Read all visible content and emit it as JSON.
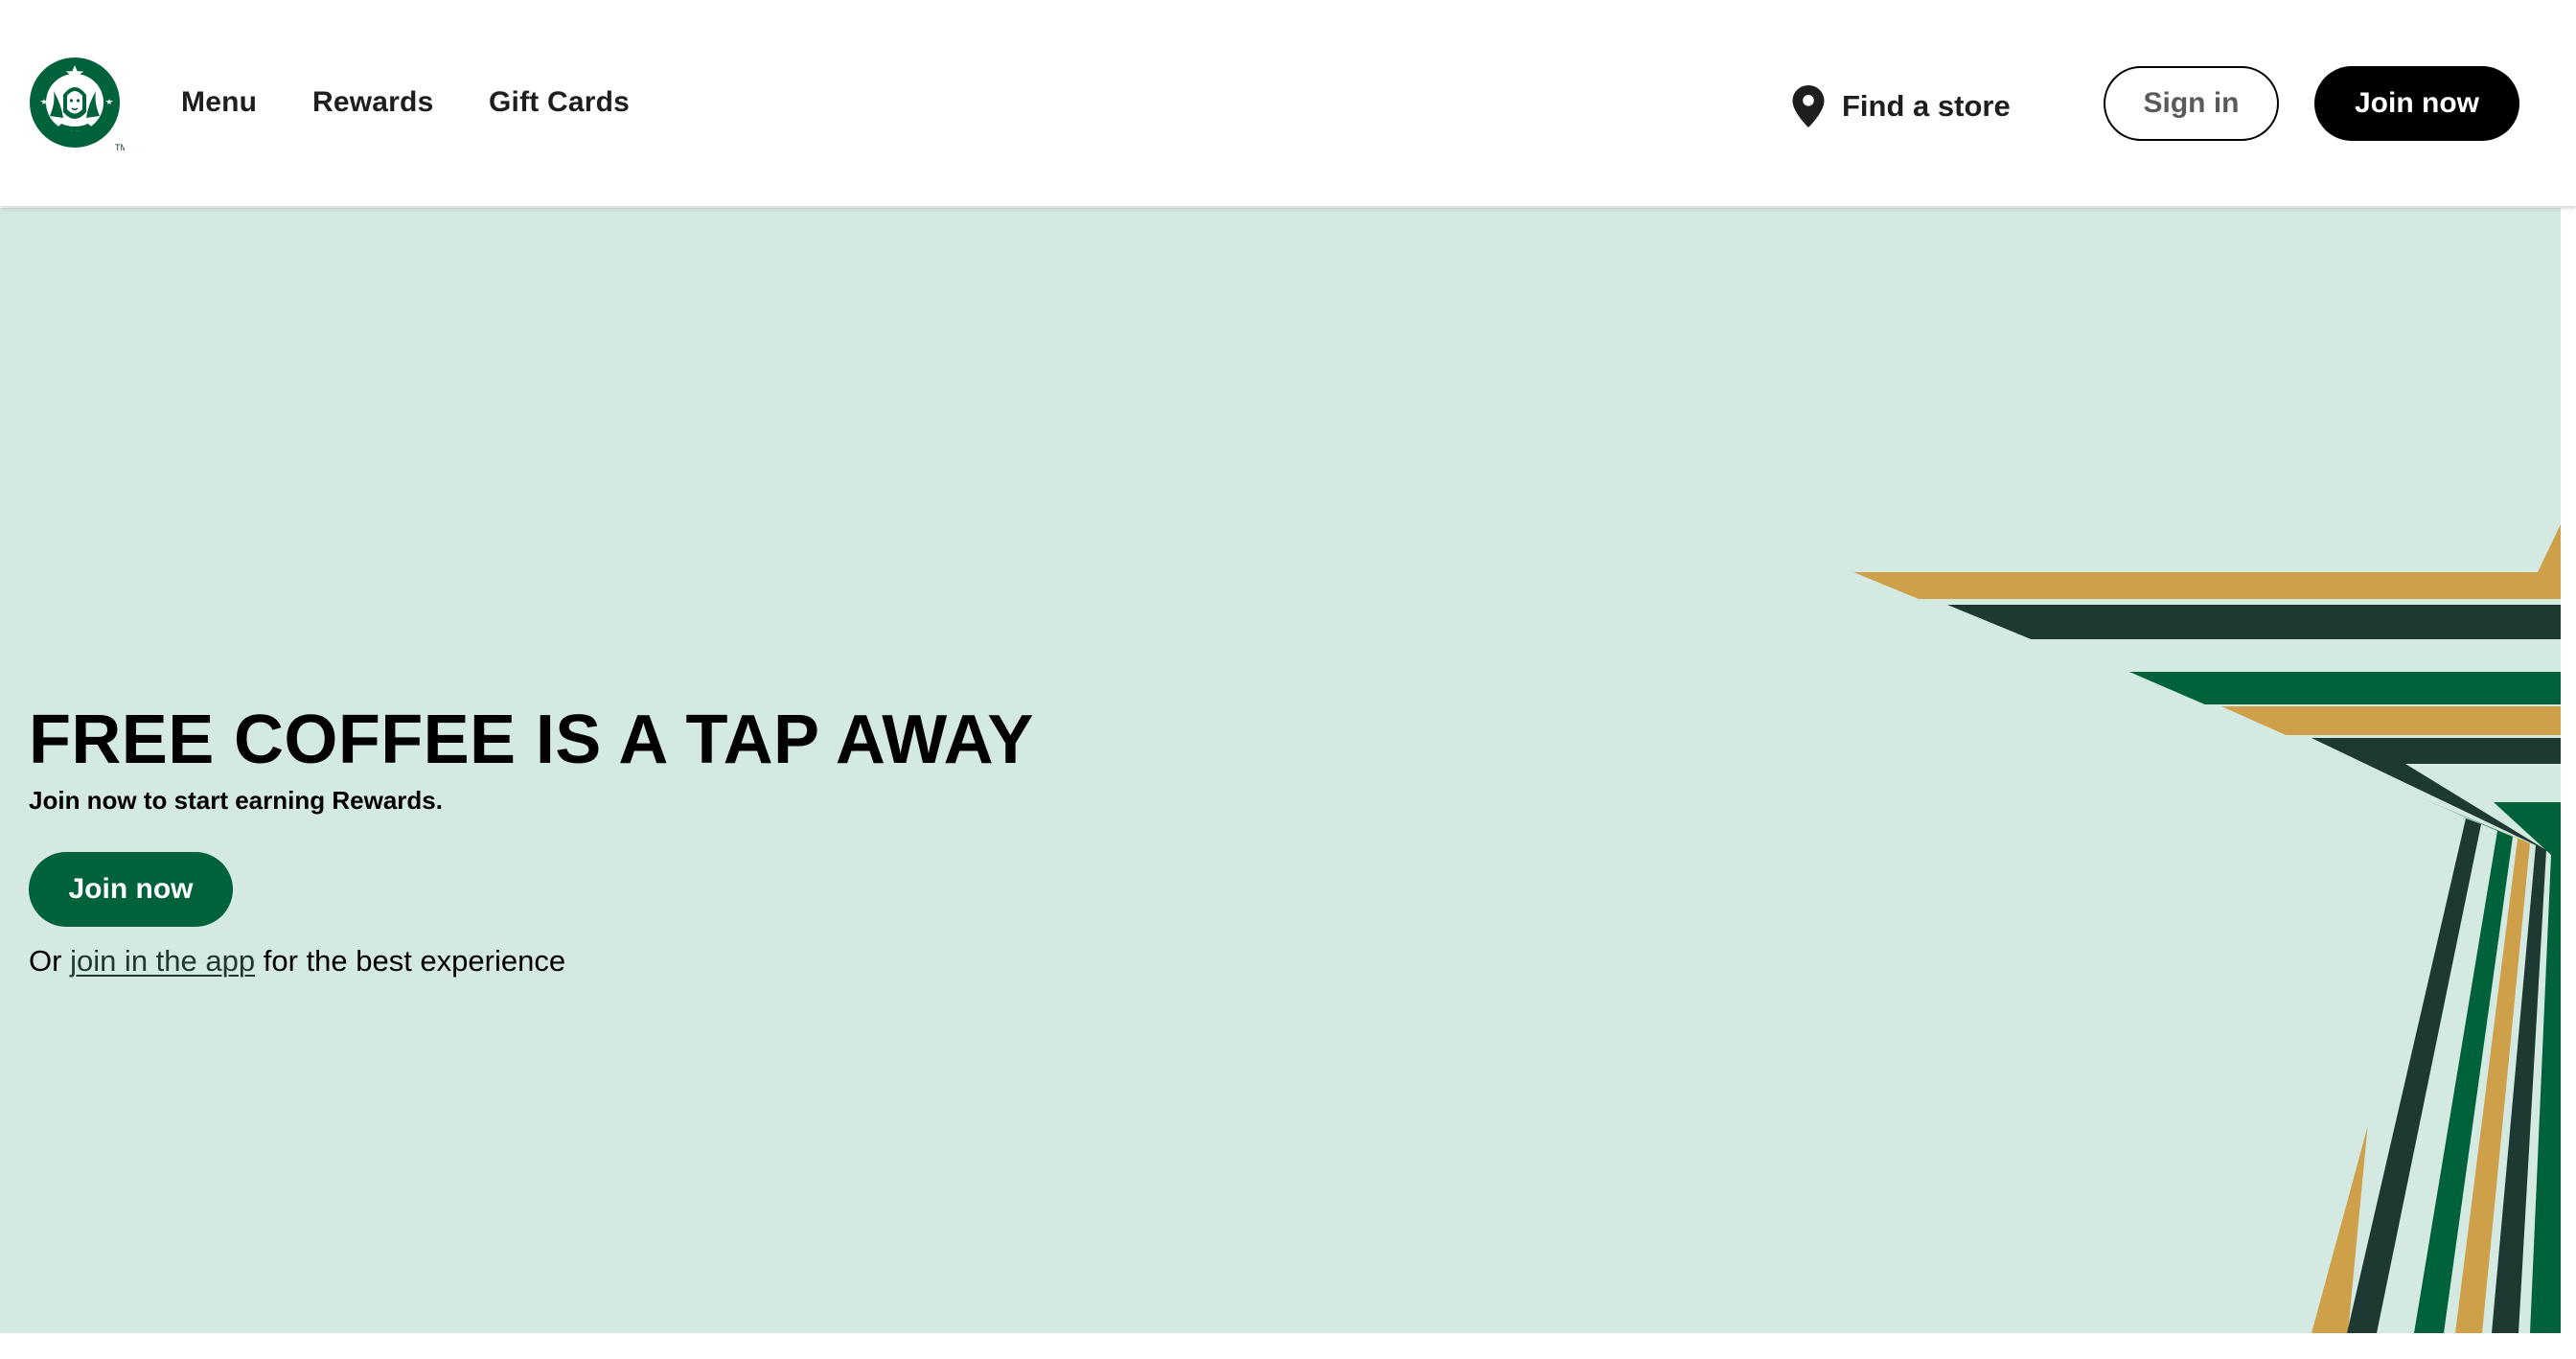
{
  "brand": {
    "logo_icon": "starbucks-siren-logo-icon",
    "trademark": "TM",
    "colors": {
      "green": "#00623b",
      "dark_green": "#1e3932",
      "gold": "#cea04a",
      "hero_bg": "#d4e9e2"
    }
  },
  "nav": {
    "items": [
      {
        "label": "Menu"
      },
      {
        "label": "Rewards"
      },
      {
        "label": "Gift Cards"
      }
    ],
    "find_store": {
      "label": "Find a store",
      "icon": "location-pin-icon"
    },
    "sign_in_label": "Sign in",
    "join_now_label": "Join now"
  },
  "hero": {
    "headline": "FREE COFFEE IS A TAP AWAY",
    "subheadline": "Join now to start earning Rewards.",
    "cta_label": "Join now",
    "alt_prefix": "Or ",
    "alt_link_label": "join in the app",
    "alt_suffix": " for the best experience",
    "graphic_icon": "starbucks-star-stripes-graphic"
  }
}
